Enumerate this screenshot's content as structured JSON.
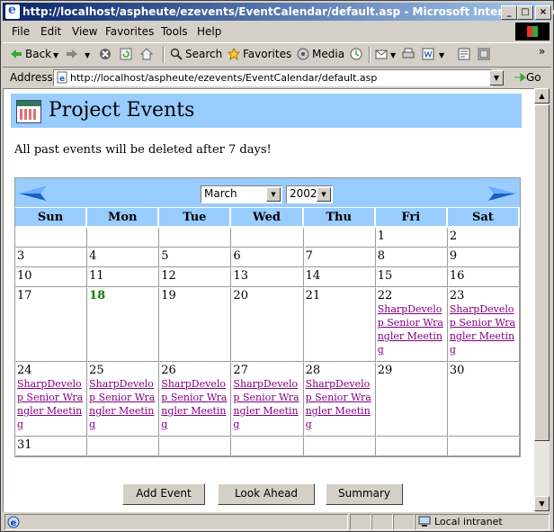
{
  "window": {
    "title": "http://localhost/aspheute/ezevents/EventCalendar/default.asp - Microsoft Internet Explorer",
    "controls": {
      "minimize": "_",
      "maximize": "□",
      "close": "×"
    }
  },
  "menu": [
    "File",
    "Edit",
    "View",
    "Favorites",
    "Tools",
    "Help"
  ],
  "toolbar": {
    "back": "Back",
    "search": "Search",
    "favorites": "Favorites",
    "media": "Media",
    "more": "»"
  },
  "address": {
    "label": "Address",
    "url": "http://localhost/aspheute/ezevents/EventCalendar/default.asp",
    "go": "Go"
  },
  "page": {
    "title": "Project Events",
    "notice": "All past events will be deleted after 7 days!",
    "month": "March",
    "year": "2002",
    "weekdays": [
      "Sun",
      "Mon",
      "Tue",
      "Wed",
      "Thu",
      "Fri",
      "Sat"
    ],
    "today": "18",
    "event_label": "SharpDevelop Senior Wrangler Meeting",
    "weeks": [
      [
        "",
        "",
        "",
        "",
        "",
        "1",
        "2"
      ],
      [
        "3",
        "4",
        "5",
        "6",
        "7",
        "8",
        "9"
      ],
      [
        "10",
        "11",
        "12",
        "13",
        "14",
        "15",
        "16"
      ],
      [
        "17",
        "18",
        "19",
        "20",
        "21",
        "22",
        "23"
      ],
      [
        "24",
        "25",
        "26",
        "27",
        "28",
        "29",
        "30"
      ],
      [
        "31",
        "",
        "",
        "",
        "",
        "",
        ""
      ]
    ],
    "event_days": [
      "22",
      "23",
      "24",
      "25",
      "26",
      "27",
      "28"
    ],
    "buttons": {
      "add": "Add Event",
      "look": "Look Ahead",
      "summary": "Summary"
    }
  },
  "status": {
    "zone": "Local intranet"
  }
}
